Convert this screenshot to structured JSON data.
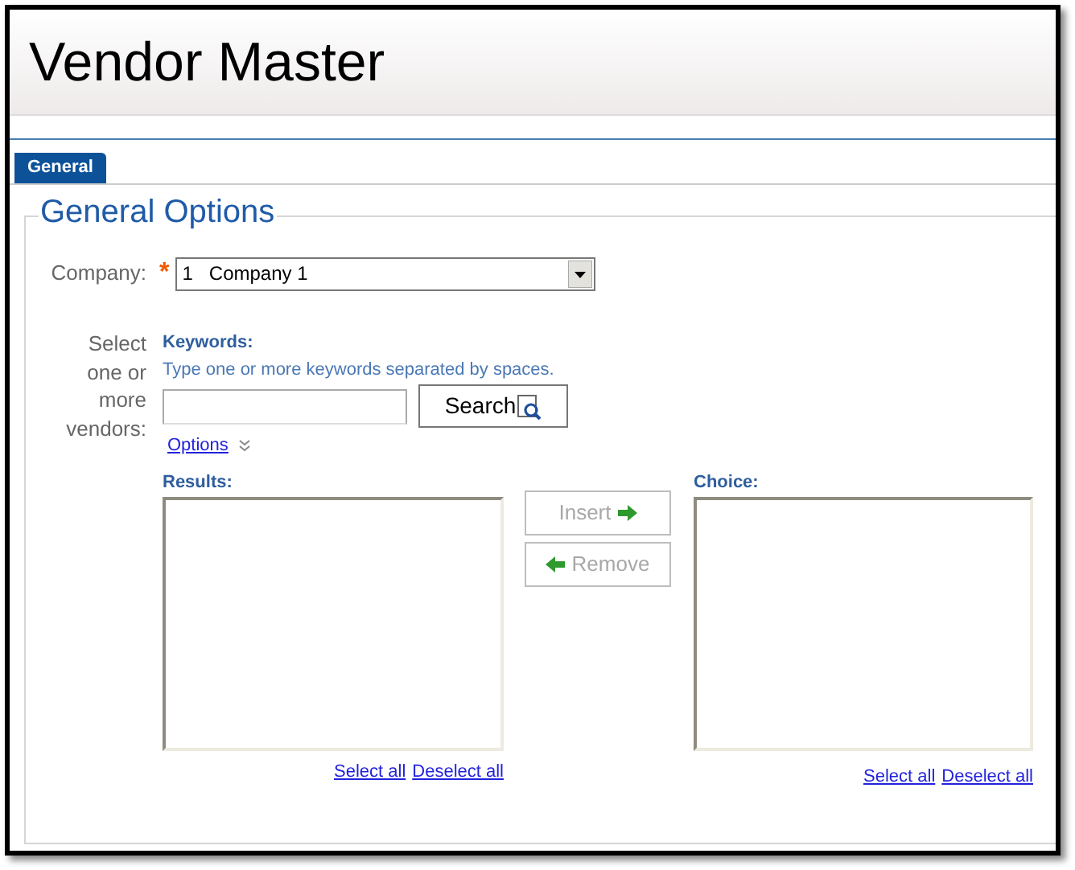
{
  "page": {
    "title": "Vendor Master"
  },
  "tabs": [
    {
      "label": "General",
      "selected": true
    }
  ],
  "section": {
    "legend": "General Options",
    "company": {
      "label": "Company:",
      "required_mark": "*",
      "value": "1   Company 1"
    },
    "vendors": {
      "label": "Select one or more vendors:",
      "keywords_label": "Keywords:",
      "hint": "Type one or more keywords separated by spaces.",
      "search_button": "Search",
      "options_link": "Options",
      "results_label": "Results:",
      "choice_label": "Choice:",
      "insert_button": {
        "label": "Insert",
        "disabled": true
      },
      "remove_button": {
        "label": "Remove",
        "disabled": true
      },
      "results_links": [
        "Select all",
        "Deselect all"
      ],
      "choice_links": [
        "Select all",
        "Deselect all"
      ]
    }
  }
}
